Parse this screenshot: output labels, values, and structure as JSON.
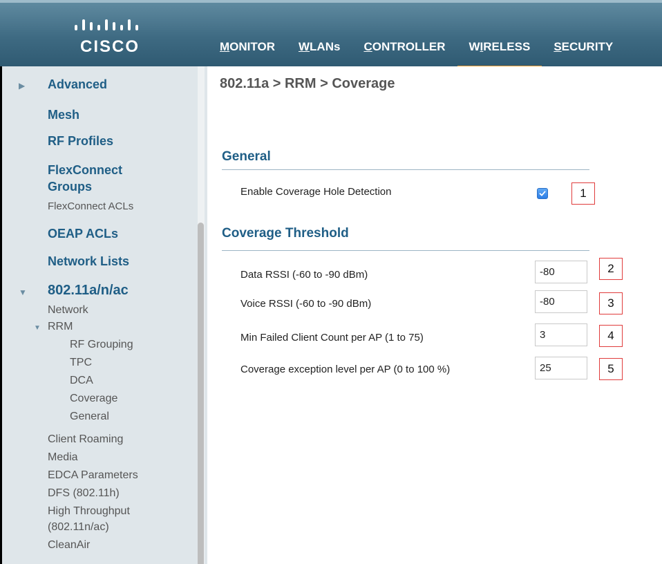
{
  "brand": {
    "logo_text": "CISCO"
  },
  "nav": [
    {
      "label": "MONITOR",
      "active": false
    },
    {
      "label": "WLANs",
      "active": false
    },
    {
      "label": "CONTROLLER",
      "active": false
    },
    {
      "label": "WIRELESS",
      "active": true
    },
    {
      "label": "SECURITY",
      "active": false
    }
  ],
  "sidebar": {
    "advanced": "Advanced",
    "mesh": "Mesh",
    "rf_profiles": "RF Profiles",
    "flexconnect_groups_1": "FlexConnect",
    "flexconnect_groups_2": "Groups",
    "flexconnect_acls": "FlexConnect ACLs",
    "oeap_acls": "OEAP ACLs",
    "network_lists": "Network Lists",
    "band": "802.11a/n/ac",
    "network": "Network",
    "rrm": "RRM",
    "rf_grouping": "RF Grouping",
    "tpc": "TPC",
    "dca": "DCA",
    "coverage": "Coverage",
    "general": "General",
    "client_roaming": "Client Roaming",
    "media": "Media",
    "edca": "EDCA Parameters",
    "dfs": "DFS (802.11h)",
    "high_throughput_1": "High Throughput",
    "high_throughput_2": "(802.11n/ac)",
    "cleanair": "CleanAir"
  },
  "main": {
    "breadcrumb": "802.11a > RRM > Coverage",
    "general_title": "General",
    "enable_label": "Enable Coverage Hole Detection",
    "enable_checked": true,
    "threshold_title": "Coverage Threshold",
    "fields": [
      {
        "label": "Data RSSI (-60 to -90 dBm)",
        "value": "-80",
        "callout": "2"
      },
      {
        "label": "Voice RSSI (-60 to -90 dBm)",
        "value": "-80",
        "callout": "3"
      },
      {
        "label": "Min Failed Client Count per AP (1 to 75)",
        "value": "3",
        "callout": "4"
      },
      {
        "label": "Coverage exception level per AP (0 to 100 %)",
        "value": "25",
        "callout": "5"
      }
    ],
    "enable_callout": "1"
  },
  "colors": {
    "accent": "#f59d32",
    "link": "#1f5e86",
    "header": "#3e6a82",
    "callout_border": "#e03b3b"
  }
}
